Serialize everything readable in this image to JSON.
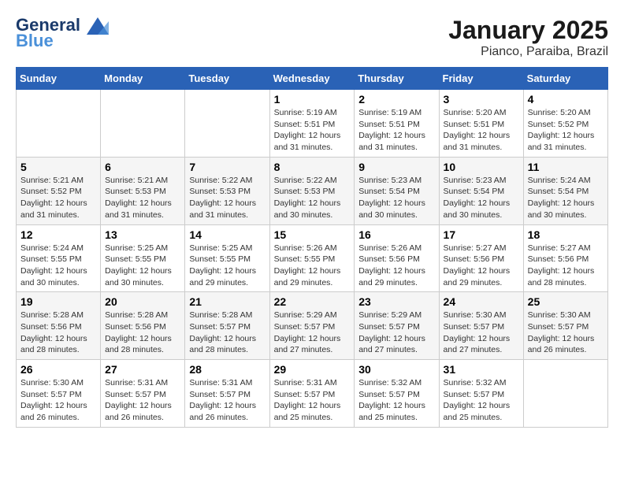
{
  "header": {
    "logo_line1": "General",
    "logo_line2": "Blue",
    "month": "January 2025",
    "location": "Pianco, Paraiba, Brazil"
  },
  "weekdays": [
    "Sunday",
    "Monday",
    "Tuesday",
    "Wednesday",
    "Thursday",
    "Friday",
    "Saturday"
  ],
  "weeks": [
    [
      {
        "day": "",
        "info": ""
      },
      {
        "day": "",
        "info": ""
      },
      {
        "day": "",
        "info": ""
      },
      {
        "day": "1",
        "info": "Sunrise: 5:19 AM\nSunset: 5:51 PM\nDaylight: 12 hours and 31 minutes."
      },
      {
        "day": "2",
        "info": "Sunrise: 5:19 AM\nSunset: 5:51 PM\nDaylight: 12 hours and 31 minutes."
      },
      {
        "day": "3",
        "info": "Sunrise: 5:20 AM\nSunset: 5:51 PM\nDaylight: 12 hours and 31 minutes."
      },
      {
        "day": "4",
        "info": "Sunrise: 5:20 AM\nSunset: 5:52 PM\nDaylight: 12 hours and 31 minutes."
      }
    ],
    [
      {
        "day": "5",
        "info": "Sunrise: 5:21 AM\nSunset: 5:52 PM\nDaylight: 12 hours and 31 minutes."
      },
      {
        "day": "6",
        "info": "Sunrise: 5:21 AM\nSunset: 5:53 PM\nDaylight: 12 hours and 31 minutes."
      },
      {
        "day": "7",
        "info": "Sunrise: 5:22 AM\nSunset: 5:53 PM\nDaylight: 12 hours and 31 minutes."
      },
      {
        "day": "8",
        "info": "Sunrise: 5:22 AM\nSunset: 5:53 PM\nDaylight: 12 hours and 30 minutes."
      },
      {
        "day": "9",
        "info": "Sunrise: 5:23 AM\nSunset: 5:54 PM\nDaylight: 12 hours and 30 minutes."
      },
      {
        "day": "10",
        "info": "Sunrise: 5:23 AM\nSunset: 5:54 PM\nDaylight: 12 hours and 30 minutes."
      },
      {
        "day": "11",
        "info": "Sunrise: 5:24 AM\nSunset: 5:54 PM\nDaylight: 12 hours and 30 minutes."
      }
    ],
    [
      {
        "day": "12",
        "info": "Sunrise: 5:24 AM\nSunset: 5:55 PM\nDaylight: 12 hours and 30 minutes."
      },
      {
        "day": "13",
        "info": "Sunrise: 5:25 AM\nSunset: 5:55 PM\nDaylight: 12 hours and 30 minutes."
      },
      {
        "day": "14",
        "info": "Sunrise: 5:25 AM\nSunset: 5:55 PM\nDaylight: 12 hours and 29 minutes."
      },
      {
        "day": "15",
        "info": "Sunrise: 5:26 AM\nSunset: 5:55 PM\nDaylight: 12 hours and 29 minutes."
      },
      {
        "day": "16",
        "info": "Sunrise: 5:26 AM\nSunset: 5:56 PM\nDaylight: 12 hours and 29 minutes."
      },
      {
        "day": "17",
        "info": "Sunrise: 5:27 AM\nSunset: 5:56 PM\nDaylight: 12 hours and 29 minutes."
      },
      {
        "day": "18",
        "info": "Sunrise: 5:27 AM\nSunset: 5:56 PM\nDaylight: 12 hours and 28 minutes."
      }
    ],
    [
      {
        "day": "19",
        "info": "Sunrise: 5:28 AM\nSunset: 5:56 PM\nDaylight: 12 hours and 28 minutes."
      },
      {
        "day": "20",
        "info": "Sunrise: 5:28 AM\nSunset: 5:56 PM\nDaylight: 12 hours and 28 minutes."
      },
      {
        "day": "21",
        "info": "Sunrise: 5:28 AM\nSunset: 5:57 PM\nDaylight: 12 hours and 28 minutes."
      },
      {
        "day": "22",
        "info": "Sunrise: 5:29 AM\nSunset: 5:57 PM\nDaylight: 12 hours and 27 minutes."
      },
      {
        "day": "23",
        "info": "Sunrise: 5:29 AM\nSunset: 5:57 PM\nDaylight: 12 hours and 27 minutes."
      },
      {
        "day": "24",
        "info": "Sunrise: 5:30 AM\nSunset: 5:57 PM\nDaylight: 12 hours and 27 minutes."
      },
      {
        "day": "25",
        "info": "Sunrise: 5:30 AM\nSunset: 5:57 PM\nDaylight: 12 hours and 26 minutes."
      }
    ],
    [
      {
        "day": "26",
        "info": "Sunrise: 5:30 AM\nSunset: 5:57 PM\nDaylight: 12 hours and 26 minutes."
      },
      {
        "day": "27",
        "info": "Sunrise: 5:31 AM\nSunset: 5:57 PM\nDaylight: 12 hours and 26 minutes."
      },
      {
        "day": "28",
        "info": "Sunrise: 5:31 AM\nSunset: 5:57 PM\nDaylight: 12 hours and 26 minutes."
      },
      {
        "day": "29",
        "info": "Sunrise: 5:31 AM\nSunset: 5:57 PM\nDaylight: 12 hours and 25 minutes."
      },
      {
        "day": "30",
        "info": "Sunrise: 5:32 AM\nSunset: 5:57 PM\nDaylight: 12 hours and 25 minutes."
      },
      {
        "day": "31",
        "info": "Sunrise: 5:32 AM\nSunset: 5:57 PM\nDaylight: 12 hours and 25 minutes."
      },
      {
        "day": "",
        "info": ""
      }
    ]
  ]
}
